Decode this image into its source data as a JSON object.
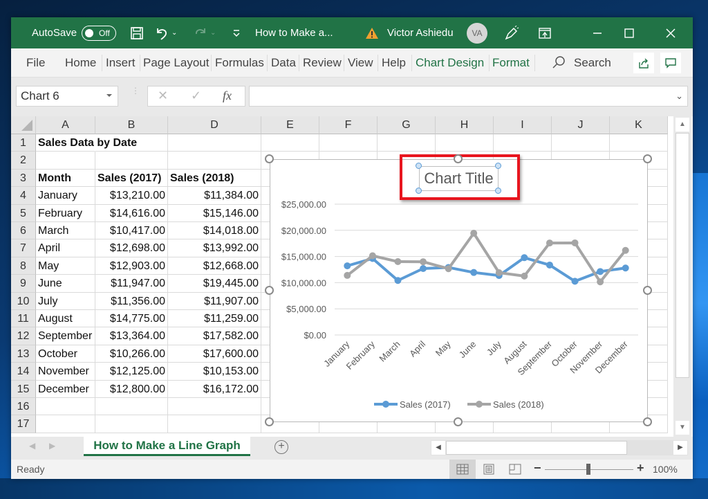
{
  "titlebar": {
    "autosave_label": "AutoSave",
    "autosave_state": "Off",
    "doc_title": "How to Make a...",
    "user_name": "Victor Ashiedu",
    "user_initials": "VA",
    "icons": [
      "save-icon",
      "undo-icon",
      "redo-icon",
      "customize-qat-icon",
      "warning-icon",
      "pen-icon",
      "ribbon-display-icon",
      "minimize-icon",
      "maximize-icon",
      "close-icon"
    ]
  },
  "ribbon": {
    "tabs": [
      {
        "label": "File"
      },
      {
        "label": "Home"
      },
      {
        "label": "Insert"
      },
      {
        "label": "Page Layout"
      },
      {
        "label": "Formulas"
      },
      {
        "label": "Data"
      },
      {
        "label": "Review"
      },
      {
        "label": "View"
      },
      {
        "label": "Help"
      },
      {
        "label": "Chart Design"
      },
      {
        "label": "Format"
      }
    ],
    "search_label": "Search",
    "accent_color": "#217346"
  },
  "formula_bar": {
    "name_box": "Chart 6",
    "cancel": "✕",
    "enter": "✓",
    "fx": "fx",
    "formula": ""
  },
  "sheet": {
    "columns": [
      "A",
      "B",
      "D",
      "E",
      "F",
      "G",
      "H",
      "I",
      "J",
      "K"
    ],
    "rows": [
      "1",
      "2",
      "3",
      "4",
      "5",
      "6",
      "7",
      "8",
      "9",
      "10",
      "11",
      "12",
      "13",
      "14",
      "15",
      "16",
      "17"
    ],
    "title": "Sales Data by Date",
    "headers": [
      "Month",
      "Sales (2017)",
      "Sales (2018)"
    ],
    "data": [
      [
        "January",
        "$13,210.00",
        "$11,384.00"
      ],
      [
        "February",
        "$14,616.00",
        "$15,146.00"
      ],
      [
        "March",
        "$10,417.00",
        "$14,018.00"
      ],
      [
        "April",
        "$12,698.00",
        "$13,992.00"
      ],
      [
        "May",
        "$12,903.00",
        "$12,668.00"
      ],
      [
        "June",
        "$11,947.00",
        "$19,445.00"
      ],
      [
        "July",
        "$11,356.00",
        "$11,907.00"
      ],
      [
        "August",
        "$14,775.00",
        "$11,259.00"
      ],
      [
        "September",
        "$13,364.00",
        "$17,582.00"
      ],
      [
        "October",
        "$10,266.00",
        "$17,600.00"
      ],
      [
        "November",
        "$12,125.00",
        "$10,153.00"
      ],
      [
        "December",
        "$12,800.00",
        "$16,172.00"
      ]
    ]
  },
  "chart_data": {
    "type": "line",
    "title": "Chart Title",
    "categories": [
      "January",
      "February",
      "March",
      "April",
      "May",
      "June",
      "July",
      "August",
      "September",
      "October",
      "November",
      "December"
    ],
    "series": [
      {
        "name": "Sales (2017)",
        "color": "#5b9bd5",
        "values": [
          13210,
          14616,
          10417,
          12698,
          12903,
          11947,
          11356,
          14775,
          13364,
          10266,
          12125,
          12800
        ]
      },
      {
        "name": "Sales (2018)",
        "color": "#a5a5a5",
        "values": [
          11384,
          15146,
          14018,
          13992,
          12668,
          19445,
          11907,
          11259,
          17582,
          17600,
          10153,
          16172
        ]
      }
    ],
    "yticks": [
      "$0.00",
      "$5,000.00",
      "$10,000.00",
      "$15,000.00",
      "$20,000.00",
      "$25,000.00"
    ],
    "ylim": [
      0,
      25000
    ],
    "xlabel": "",
    "ylabel": "",
    "grid": true,
    "legend": "bottom",
    "highlight_color": "#e8151e"
  },
  "sheet_tabs": {
    "active": "How to Make a Line Graph",
    "add_label": "+"
  },
  "statusbar": {
    "status": "Ready",
    "zoom": "100%",
    "zoom_minus": "−",
    "zoom_plus": "+"
  }
}
